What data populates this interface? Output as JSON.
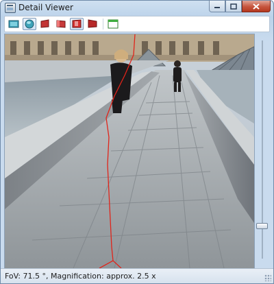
{
  "window": {
    "title": "Detail Viewer",
    "controls": {
      "minimize_icon": "minimize-icon",
      "maximize_icon": "maximize-icon",
      "close_icon": "close-icon"
    }
  },
  "toolbar": {
    "buttons": [
      {
        "icon": "rectangular-projection-icon",
        "active": false
      },
      {
        "icon": "spherical-projection-icon",
        "active": true
      },
      {
        "icon": "flag-left-icon",
        "active": false
      },
      {
        "icon": "flag-mid-icon",
        "active": false
      },
      {
        "icon": "flag-red-icon",
        "active": true
      },
      {
        "icon": "flag-right-icon",
        "active": false
      },
      {
        "icon": "window-icon",
        "active": false
      }
    ]
  },
  "viewer": {
    "image": "louvre-pyramid-walkway-photo",
    "seam_color": "#e0241a"
  },
  "zoom": {
    "level_fraction": 0.86
  },
  "status": {
    "text": "FoV: 71.5 °, Magnification: approx. 2.5 x"
  }
}
